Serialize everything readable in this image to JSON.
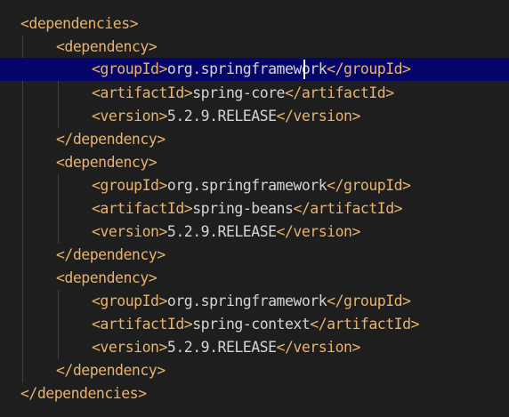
{
  "editor": {
    "lines": [
      {
        "indent": 0,
        "open": "<dependencies>",
        "text": "",
        "close": ""
      },
      {
        "indent": 1,
        "open": "<dependency>",
        "text": "",
        "close": ""
      },
      {
        "indent": 2,
        "open": "<groupId>",
        "text": "org.springframework",
        "close": "</groupId>"
      },
      {
        "indent": 2,
        "open": "<artifactId>",
        "text": "spring-core",
        "close": "</artifactId>"
      },
      {
        "indent": 2,
        "open": "<version>",
        "text": "5.2.9.RELEASE",
        "close": "</version>"
      },
      {
        "indent": 1,
        "open": "</dependency>",
        "text": "",
        "close": ""
      },
      {
        "indent": 1,
        "open": "<dependency>",
        "text": "",
        "close": ""
      },
      {
        "indent": 2,
        "open": "<groupId>",
        "text": "org.springframework",
        "close": "</groupId>"
      },
      {
        "indent": 2,
        "open": "<artifactId>",
        "text": "spring-beans",
        "close": "</artifactId>"
      },
      {
        "indent": 2,
        "open": "<version>",
        "text": "5.2.9.RELEASE",
        "close": "</version>"
      },
      {
        "indent": 1,
        "open": "</dependency>",
        "text": "",
        "close": ""
      },
      {
        "indent": 1,
        "open": "<dependency>",
        "text": "",
        "close": ""
      },
      {
        "indent": 2,
        "open": "<groupId>",
        "text": "org.springframework",
        "close": "</groupId>"
      },
      {
        "indent": 2,
        "open": "<artifactId>",
        "text": "spring-context",
        "close": "</artifactId>"
      },
      {
        "indent": 2,
        "open": "<version>",
        "text": "5.2.9.RELEASE",
        "close": "</version>"
      },
      {
        "indent": 1,
        "open": "</dependency>",
        "text": "",
        "close": ""
      },
      {
        "indent": 0,
        "open": "</dependencies>",
        "text": "",
        "close": ""
      }
    ]
  },
  "colors": {
    "background": "#1e1e1e",
    "tag": "#e8b36a",
    "text": "#d4d4d4",
    "current_line": "#06066a",
    "indent_guide": "#404040",
    "cursor": "#ffffff"
  }
}
